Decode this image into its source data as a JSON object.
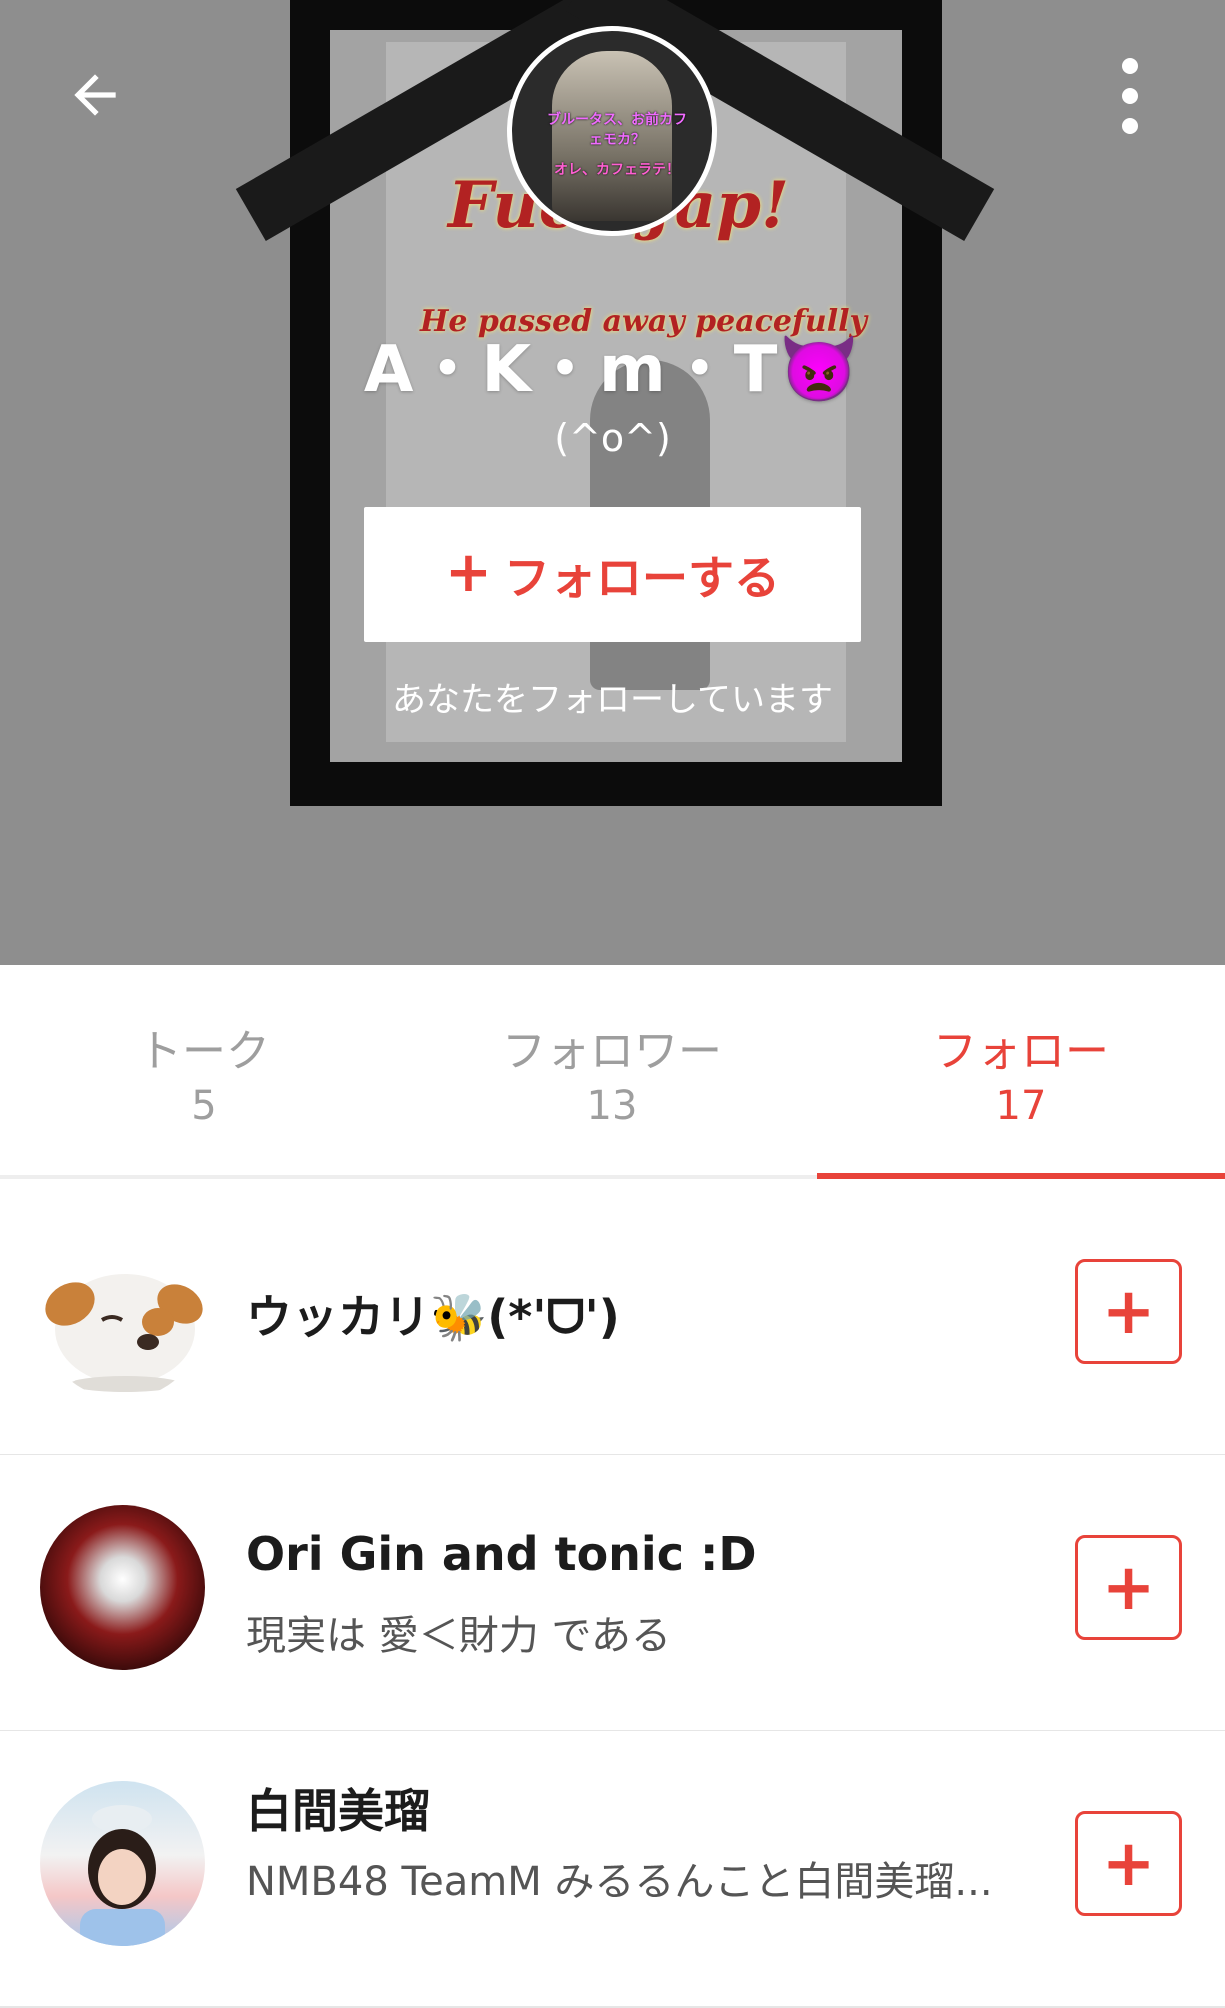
{
  "profile": {
    "name": "A・K・m・T👿",
    "status_message": "(^o^)",
    "follow_button": "フォローする",
    "follows_you_text": "あなたをフォローしています",
    "avatar_caption_1": "ブルータス、お前カフェモカ？",
    "avatar_caption_2": "オレ、カフェラテ！",
    "cover_text_1": "Fuck Jap!",
    "cover_text_2": "He passed away peacefully"
  },
  "tabs": [
    {
      "label": "トーク",
      "count": "5"
    },
    {
      "label": "フォロワー",
      "count": "13"
    },
    {
      "label": "フォロー",
      "count": "17",
      "active": true
    }
  ],
  "users": [
    {
      "name": "ウッカリ🐝(*'ᗜ')",
      "subtitle": "",
      "avatar": "dog-avatar"
    },
    {
      "name": "Ori Gin and tonic :D",
      "subtitle": "現実は 愛＜財力 である",
      "avatar": "red-art-avatar"
    },
    {
      "name": "白間美瑠",
      "subtitle": "NMB48 TeamM みるるんこと白間美瑠...",
      "avatar": "girl-photo-avatar"
    }
  ],
  "colors": {
    "accent": "#e8433a",
    "header_bg": "#8e8e8e",
    "inactive_tab": "#9e9e9e"
  },
  "icons": {
    "back": "arrow-left-icon",
    "menu": "more-vertical-icon",
    "add": "plus-icon"
  }
}
